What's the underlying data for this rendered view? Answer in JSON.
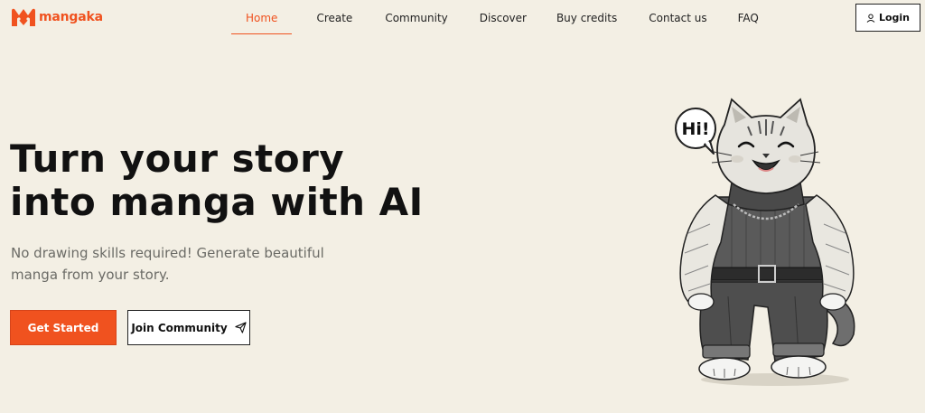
{
  "brand": {
    "name": "mangaka",
    "color": "#f0521f"
  },
  "nav": {
    "items": [
      {
        "label": "Home",
        "active": true
      },
      {
        "label": "Create",
        "active": false
      },
      {
        "label": "Community",
        "active": false
      },
      {
        "label": "Discover",
        "active": false
      },
      {
        "label": "Buy credits",
        "active": false
      },
      {
        "label": "Contact us",
        "active": false
      },
      {
        "label": "FAQ",
        "active": false
      }
    ],
    "login_label": "Login",
    "login_icon": "user-icon"
  },
  "hero": {
    "title_line1": "Turn your story",
    "title_line2": "into manga with AI",
    "subtitle": "No drawing skills required! Generate beautiful manga from your story.",
    "primary_button": "Get Started",
    "secondary_button": "Join Community",
    "secondary_icon": "send-icon"
  },
  "illustration": {
    "speech_bubble": "Hi!",
    "subject": "cat-mascot"
  },
  "colors": {
    "background": "#f3efe4",
    "accent": "#f0521f",
    "text": "#111111",
    "muted": "#6b6b66"
  }
}
